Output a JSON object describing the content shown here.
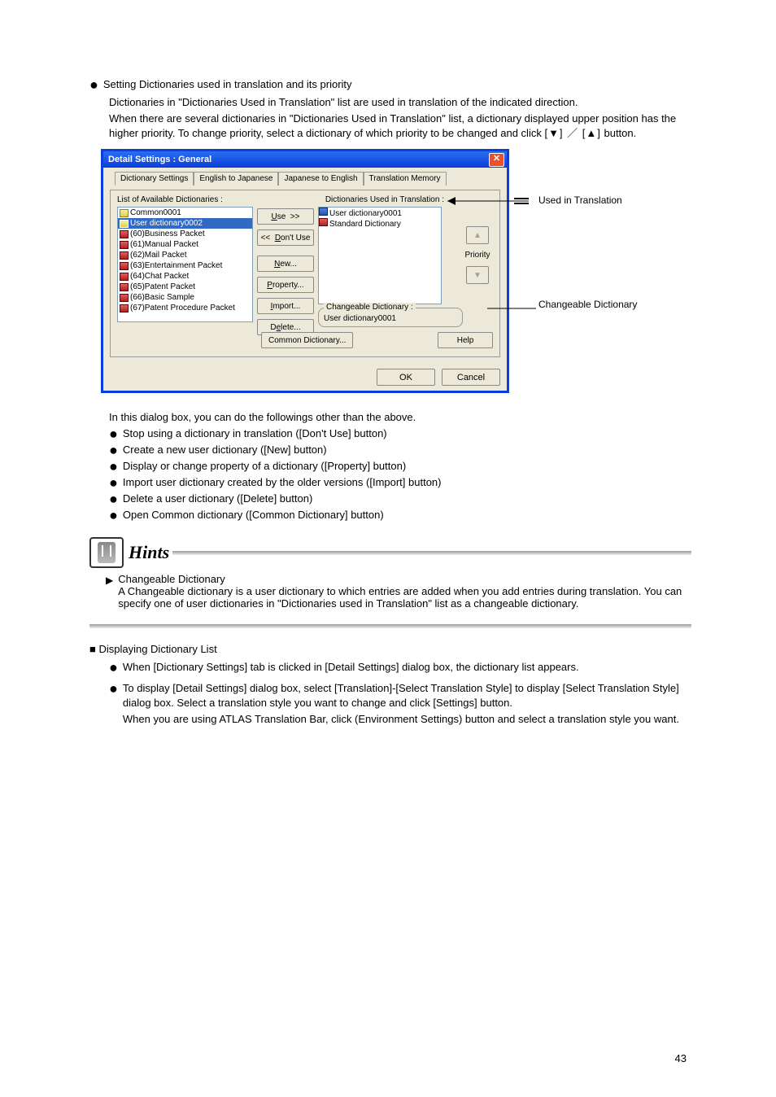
{
  "page_number": "43",
  "intro_bullet": "Setting Dictionaries used in translation and its priority",
  "intro_para1": "Dictionaries in \"Dictionaries Used in Translation\" list are used in translation of the indicated direction.",
  "intro_para2": "When there are several dictionaries in \"Dictionaries Used in Translation\" list, a dictionary displayed upper position has the higher priority. To change priority, select a dictionary of which priority to be changed and click",
  "intro_buttons": "[▼] ／ [▲]",
  "intro_para2_tail": " button.",
  "dialog": {
    "title": "Detail Settings : General",
    "tabs": [
      "Dictionary Settings",
      "English to Japanese",
      "Japanese to English",
      "Translation Memory"
    ],
    "left_label": "List of Available Dictionaries :",
    "right_label": "Dictionaries Used in Translation :",
    "available": [
      {
        "icon": "user",
        "text": "Common0001"
      },
      {
        "icon": "user",
        "text": "User dictionary0002",
        "selected": true
      },
      {
        "icon": "book",
        "text": "(60)Business Packet"
      },
      {
        "icon": "book",
        "text": "(61)Manual Packet"
      },
      {
        "icon": "book",
        "text": "(62)Mail Packet"
      },
      {
        "icon": "book",
        "text": "(63)Entertainment Packet"
      },
      {
        "icon": "book",
        "text": "(64)Chat Packet"
      },
      {
        "icon": "book",
        "text": "(65)Patent Packet"
      },
      {
        "icon": "book",
        "text": "(66)Basic Sample"
      },
      {
        "icon": "book",
        "text": "(67)Patent Procedure Packet"
      }
    ],
    "mid_buttons": {
      "use": "Use  >>",
      "dont_use": "<<  Don't Use",
      "new": "New...",
      "property": "Property...",
      "import": "Import...",
      "delete": "Delete..."
    },
    "used": [
      {
        "icon": "book-used",
        "text": "User dictionary0001",
        "selected": true
      },
      {
        "icon": "book",
        "text": "Standard Dictionary"
      }
    ],
    "priority_label": "Priority",
    "changeable_label": "Changeable Dictionary :",
    "changeable_value": "User dictionary0001",
    "common_btn": "Common Dictionary...",
    "help_btn": "Help",
    "ok": "OK",
    "cancel": "Cancel"
  },
  "callout_right_1": "Used in Translation",
  "callout_right_2": "Changeable Dictionary",
  "list_intro": "In this dialog box, you can do the followings other than the above.",
  "list_items": [
    "Stop using a dictionary in translation ([Don't Use] button)",
    "Create a new user dictionary ([New] button)",
    "Display or change property of a dictionary ([Property] button)",
    "Import user dictionary created by the older versions ([Import] button)",
    "Delete a user dictionary ([Delete] button)",
    "Open Common dictionary ([Common Dictionary] button)"
  ],
  "hints_title": "Hints",
  "hints_body1": "Changeable Dictionary",
  "hints_body2": "A Changeable dictionary is a user dictionary to which entries are added when you add entries during translation. You can specify one of user dictionaries in \"Dictionaries used in Translation\" list as a changeable dictionary.",
  "heading2": "■ Displaying Dictionary List",
  "b1": "When [Dictionary Settings] tab is clicked in [Detail Settings] dialog box, the dictionary list appears.",
  "b2_a": "To display [Detail Settings] dialog box, select [Translation]-[Select Translation Style] to display [Select Translation Style] dialog box. Select a translation style you want to change and click [Settings] button.",
  "b2_b": "When you are using ATLAS Translation Bar, click  (Environment Settings) button and select a translation style you want."
}
